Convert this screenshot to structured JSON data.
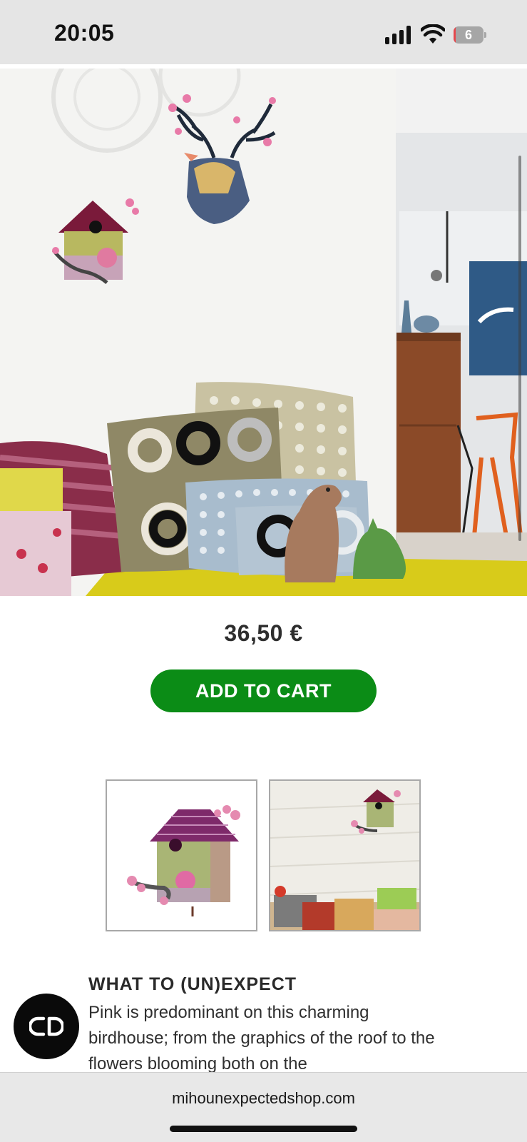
{
  "status_bar": {
    "time": "20:05",
    "battery_level": "6",
    "battery_fraction": 0.06,
    "icons": [
      "signal-icon",
      "wifi-icon",
      "battery-icon"
    ]
  },
  "hero": {
    "image": "living-room-with-birdhouse-and-deer-head-wall-decor"
  },
  "product": {
    "price": "36,50 €",
    "add_to_cart_label": "ADD TO CART"
  },
  "thumbnails": [
    {
      "name": "birdhouse-product-thumbnail"
    },
    {
      "name": "birdhouse-on-wall-thumbnail"
    }
  ],
  "description": {
    "title": "WHAT TO (UN)EXPECT",
    "body": "Pink is predominant on this charming birdhouse; from the graphics of the roof to the flowers blooming both on the"
  },
  "chat": {
    "icon": "chat-link-icon"
  },
  "browser": {
    "url": "mihounexpectedshop.com"
  },
  "colors": {
    "accent_green": "#0b8c16",
    "text_dark": "#2e2e2e",
    "status_bar_bg": "#e5e5e5",
    "battery_low": "#e5484d"
  }
}
